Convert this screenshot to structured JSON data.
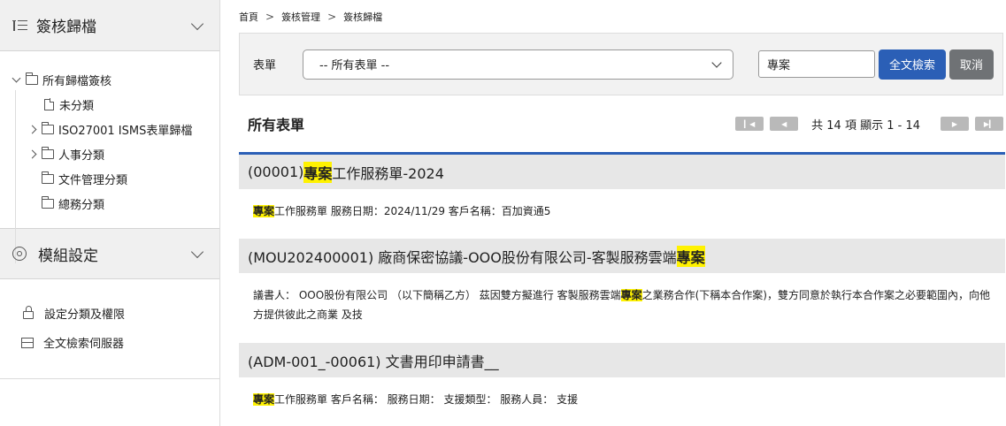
{
  "sidebar": {
    "section1_title": "簽核歸檔",
    "tree": {
      "root": "所有歸檔簽核",
      "items": [
        "未分類",
        "ISO27001 ISMS表單歸檔",
        "人事分類",
        "文件管理分類",
        "總務分類"
      ]
    },
    "section2_title": "模組設定",
    "menu": [
      "設定分類及權限",
      "全文檢索伺服器"
    ]
  },
  "breadcrumb": [
    "首頁",
    "簽核管理",
    "簽核歸檔"
  ],
  "filter": {
    "form_label": "表單",
    "form_select_value": "-- 所有表單 --",
    "search_value": "專案",
    "search_button": "全文檢索",
    "cancel_button": "取消"
  },
  "list": {
    "title": "所有表單",
    "pager_info": "共 14 項 顯示 1 - 14"
  },
  "results": [
    {
      "title_prefix": "(00001) ",
      "title_hl": "專案",
      "title_suffix": "工作服務單-2024",
      "body_hl": "專案",
      "body_text": "工作服務單 服務日期：2024/11/29 客戶名稱：百加資通5"
    },
    {
      "title_prefix": "(MOU202400001) 廠商保密協議-OOO股份有限公司-客製服務雲端",
      "title_hl": "專案",
      "body_pre": "議書人： OOO股份有限公司 （以下簡稱乙方） 茲因雙方擬進行 客製服務雲端",
      "body_hl": "專案",
      "body_post": "之業務合作(下稱本合作案)，雙方同意於執行本合作案之必要範圍內，向他方提供彼此之商業 及技"
    },
    {
      "title_text": "(ADM-001_-00061) 文書用印申請書__",
      "body_hl": "專案",
      "body_text": "工作服務單 客戶名稱： 服務日期： 支援類型： 服務人員： 支援"
    }
  ]
}
